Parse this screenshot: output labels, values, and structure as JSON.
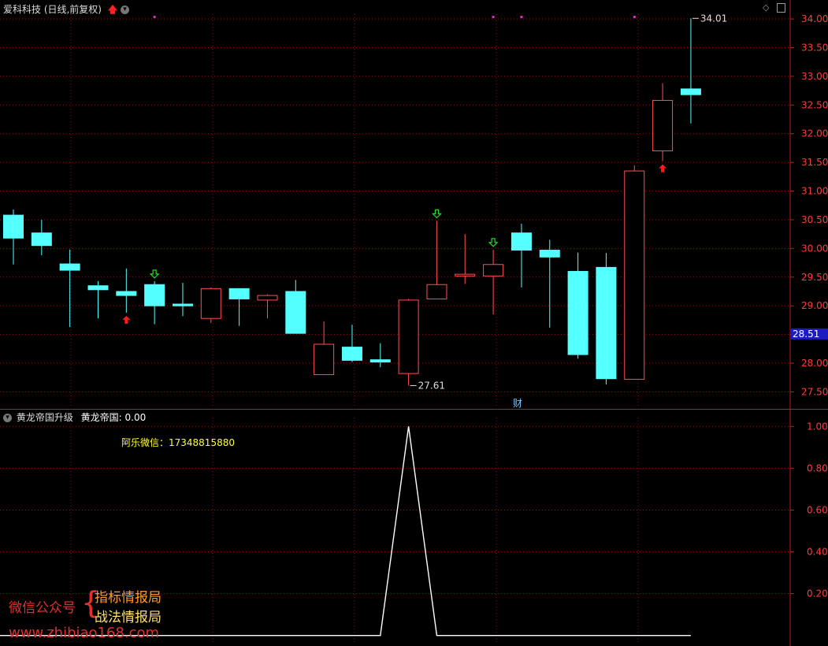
{
  "header": {
    "stock_title": "爱科科技 (日线,前复权)",
    "indicator_name": "黄龙帝国升级",
    "indicator_value_label": "黄龙帝国: 0.00",
    "contact_text": "阿乐微信：17348815880",
    "cai_badge": "财",
    "last_price": "28.51"
  },
  "watermark": {
    "prefix": "微信公众号",
    "line1": "指标情报局",
    "line2": "战法情报局",
    "url": "www.zhibiao168.com"
  },
  "colors": {
    "up": "#ff5050",
    "down": "#54ffff",
    "grid": "#8a1010",
    "axis": "#c01a1a",
    "label": "#ff3b3b",
    "signal_buy": "#ff1a1a",
    "signal_sell": "#22dd22",
    "indicator_line": "#ffffff",
    "marker": "#cc33cc"
  },
  "chart_data": [
    {
      "type": "candlestick",
      "yticks": [
        27.5,
        28.0,
        28.5,
        29.0,
        29.5,
        30.0,
        30.5,
        31.0,
        31.5,
        32.0,
        32.5,
        33.0,
        33.5,
        34.0
      ],
      "ylim": [
        27.3,
        34.22
      ],
      "annotations": [
        {
          "text": "34.01",
          "index": 24,
          "value": 34.01
        },
        {
          "text": "27.61",
          "index": 14,
          "value": 27.61
        }
      ],
      "candles": [
        {
          "o": 30.58,
          "h": 30.68,
          "l": 29.72,
          "c": 30.18
        },
        {
          "o": 30.27,
          "h": 30.5,
          "l": 29.88,
          "c": 30.05
        },
        {
          "o": 29.73,
          "h": 29.98,
          "l": 28.63,
          "c": 29.62
        },
        {
          "o": 29.35,
          "h": 29.43,
          "l": 28.78,
          "c": 29.28
        },
        {
          "o": 29.25,
          "h": 29.65,
          "l": 28.88,
          "c": 29.18
        },
        {
          "o": 29.37,
          "h": 29.43,
          "l": 28.68,
          "c": 29.0
        },
        {
          "o": 29.03,
          "h": 29.4,
          "l": 28.82,
          "c": 29.0
        },
        {
          "o": 28.78,
          "h": 29.32,
          "l": 28.7,
          "c": 29.3
        },
        {
          "o": 29.3,
          "h": 29.3,
          "l": 28.65,
          "c": 29.12
        },
        {
          "o": 29.1,
          "h": 29.2,
          "l": 28.78,
          "c": 29.18
        },
        {
          "o": 29.25,
          "h": 29.45,
          "l": 28.52,
          "c": 28.52
        },
        {
          "o": 27.8,
          "h": 28.73,
          "l": 27.8,
          "c": 28.33
        },
        {
          "o": 28.28,
          "h": 28.67,
          "l": 28.02,
          "c": 28.05
        },
        {
          "o": 28.06,
          "h": 28.35,
          "l": 27.93,
          "c": 28.02
        },
        {
          "o": 27.82,
          "h": 29.12,
          "l": 27.61,
          "c": 29.1
        },
        {
          "o": 29.12,
          "h": 30.48,
          "l": 29.12,
          "c": 29.37
        },
        {
          "o": 29.52,
          "h": 30.25,
          "l": 29.38,
          "c": 29.55
        },
        {
          "o": 29.52,
          "h": 29.98,
          "l": 28.85,
          "c": 29.72
        },
        {
          "o": 30.27,
          "h": 30.43,
          "l": 29.32,
          "c": 29.97
        },
        {
          "o": 29.97,
          "h": 30.15,
          "l": 28.62,
          "c": 29.85
        },
        {
          "o": 29.6,
          "h": 29.93,
          "l": 28.08,
          "c": 28.15
        },
        {
          "o": 29.67,
          "h": 29.92,
          "l": 27.63,
          "c": 27.73
        },
        {
          "o": 27.72,
          "h": 31.45,
          "l": 27.72,
          "c": 31.35
        },
        {
          "o": 31.7,
          "h": 32.88,
          "l": 31.52,
          "c": 32.58
        },
        {
          "o": 32.78,
          "h": 34.01,
          "l": 32.18,
          "c": 32.68
        }
      ],
      "buy_signals": [
        4,
        23
      ],
      "sell_signals": [
        5,
        15,
        17
      ],
      "top_markers": [
        5,
        17,
        18,
        22
      ]
    },
    {
      "type": "line",
      "yticks": [
        0.2,
        0.4,
        0.6,
        0.8,
        1.0
      ],
      "ylim": [
        -0.02,
        1.05
      ],
      "x_end_index": 24,
      "peaks": [
        {
          "index": 14,
          "value": 1.0
        }
      ]
    }
  ]
}
